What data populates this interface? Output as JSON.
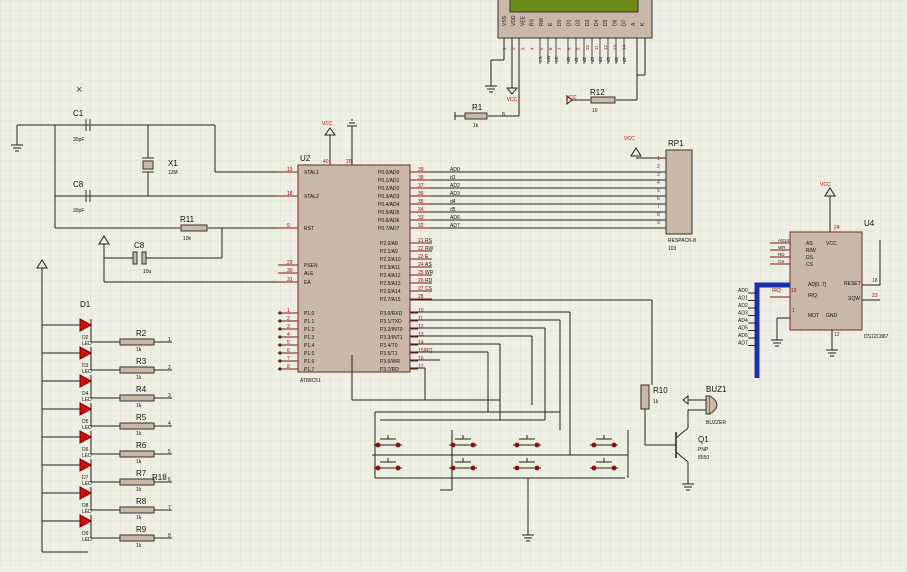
{
  "schematic": {
    "lcd": {
      "pins": [
        "VSS",
        "VDD",
        "VEE",
        "RS",
        "RW",
        "E",
        "D0",
        "D1",
        "D2",
        "D3",
        "D4",
        "D5",
        "D6",
        "D7",
        "A",
        "K"
      ],
      "pin_numbers": [
        "1",
        "2",
        "3",
        "4",
        "5",
        "6",
        "7",
        "8",
        "9",
        "10",
        "11",
        "12",
        "13",
        "14"
      ],
      "data_labels": [
        "d0",
        "d1",
        "d2",
        "d3",
        "d4",
        "d5",
        "d6",
        "d7"
      ],
      "ctrl_labels": [
        "LS",
        "LW",
        "LE"
      ]
    },
    "mcu": {
      "ref": "U2",
      "part": "AT89C51",
      "left_pins": [
        {
          "name": "XTAL1",
          "num": "19"
        },
        {
          "name": "XTAL2",
          "num": "18"
        },
        {
          "name": "RST",
          "num": "9"
        },
        {
          "name": "PSEN",
          "num": "29"
        },
        {
          "name": "ALE",
          "num": "30"
        },
        {
          "name": "EA",
          "num": "31"
        },
        {
          "name": "P1.0",
          "num": "1"
        },
        {
          "name": "P1.1",
          "num": "2"
        },
        {
          "name": "P1.2",
          "num": "3"
        },
        {
          "name": "P1.3",
          "num": "4"
        },
        {
          "name": "P1.4",
          "num": "5"
        },
        {
          "name": "P1.5",
          "num": "6"
        },
        {
          "name": "P1.6",
          "num": "7"
        },
        {
          "name": "P1.7",
          "num": "8"
        }
      ],
      "p0_pins": [
        {
          "name": "P0.0/AD0",
          "num": "39",
          "net": "AD0"
        },
        {
          "name": "P0.1/AD1",
          "num": "38",
          "net": "d1"
        },
        {
          "name": "P0.2/AD2",
          "num": "37",
          "net": "AD2"
        },
        {
          "name": "P0.3/AD3",
          "num": "36",
          "net": "AD3"
        },
        {
          "name": "P0.4/AD4",
          "num": "35",
          "net": "d4"
        },
        {
          "name": "P0.5/AD5",
          "num": "34",
          "net": "d5"
        },
        {
          "name": "P0.6/AD6",
          "num": "33",
          "net": "AD6"
        },
        {
          "name": "P0.7/AD7",
          "num": "32",
          "net": "AD7"
        }
      ],
      "p2_pins": [
        {
          "name": "P2.0/A8",
          "num": "21",
          "net": "RS"
        },
        {
          "name": "P2.1/A9",
          "num": "22",
          "net": "RW"
        },
        {
          "name": "P2.2/A10",
          "num": "23",
          "net": "E"
        },
        {
          "name": "P2.3/A11",
          "num": "24",
          "net": "AS"
        },
        {
          "name": "P2.4/A12",
          "num": "25",
          "net": "WR"
        },
        {
          "name": "P2.5/A13",
          "num": "26",
          "net": "RD"
        },
        {
          "name": "P2.6/A14",
          "num": "27",
          "net": "CS"
        },
        {
          "name": "P2.7/A15",
          "num": "28",
          "net": ""
        }
      ],
      "p3_pins": [
        {
          "name": "P3.0/RXD",
          "num": "10"
        },
        {
          "name": "P3.1/TXD",
          "num": "11"
        },
        {
          "name": "P3.2/INT0",
          "num": "12"
        },
        {
          "name": "P3.3/INT1",
          "num": "13"
        },
        {
          "name": "P3.4/T0",
          "num": "14"
        },
        {
          "name": "P3.5/T1",
          "num": "15IRQ"
        },
        {
          "name": "P3.6/WR",
          "num": "16"
        },
        {
          "name": "P3.7/RD",
          "num": "17"
        }
      ],
      "top_pins": [
        "40",
        "20"
      ]
    },
    "rtc": {
      "ref": "U4",
      "part": "DS12C887",
      "left_pins": [
        "AS",
        "R/W",
        "DS",
        "CS"
      ],
      "bus": "AD[0..7]",
      "irq": "IRQ",
      "irq_num": "19",
      "mot": "MOT",
      "gnd": "GND",
      "vcc": "VCC",
      "reset": "RESET",
      "sqw": "SQW",
      "nums": {
        "vcc": "24",
        "reset": "18",
        "sqw": "23",
        "mot": "1",
        "gnd": "12"
      },
      "bus_labels": [
        "AD0",
        "AD1",
        "AD2",
        "AD3",
        "AD4",
        "AD5",
        "AD6",
        "AD7"
      ],
      "ctrl_labels": [
        "AS14",
        "WR",
        "RD",
        "CS"
      ]
    },
    "rp1": {
      "ref": "RP1",
      "value": "103",
      "type": "RESPACK-8",
      "pins": [
        "1",
        "2",
        "3",
        "4",
        "5",
        "6",
        "7",
        "8",
        "9"
      ]
    },
    "crystal": {
      "ref": "X1",
      "value": "12M"
    },
    "caps": [
      {
        "ref": "C1",
        "value": "30pF"
      },
      {
        "ref": "C8",
        "value": "30pF"
      },
      {
        "ref": "C8",
        "value": "10u"
      }
    ],
    "r11": {
      "ref": "R11",
      "value": "10k"
    },
    "r1": {
      "ref": "R1",
      "value": "1k",
      "net": "8"
    },
    "r12": {
      "ref": "R12",
      "value": "10"
    },
    "r10": {
      "ref": "R10",
      "value": "1k"
    },
    "buzzer": {
      "ref": "BUZ1",
      "value": "BUZZER"
    },
    "q1": {
      "ref": "Q1",
      "type": "PNP",
      "value": "8550"
    },
    "led_first": "D1",
    "leds": [
      {
        "ref": "D2",
        "type": "LED"
      },
      {
        "ref": "D3",
        "type": "LED"
      },
      {
        "ref": "D4",
        "type": "LED"
      },
      {
        "ref": "D5",
        "type": "LED"
      },
      {
        "ref": "D6",
        "type": "LED"
      },
      {
        "ref": "D7",
        "type": "LED"
      },
      {
        "ref": "D8",
        "type": "LED"
      },
      {
        "ref": "D9",
        "type": "LED"
      }
    ],
    "led_resistors": [
      {
        "ref": "R2",
        "value": "1k",
        "num": "1"
      },
      {
        "ref": "R3",
        "value": "1k",
        "num": "2"
      },
      {
        "ref": "R4",
        "value": "1k",
        "num": "3"
      },
      {
        "ref": "R5",
        "value": "1k",
        "num": "4"
      },
      {
        "ref": "R6",
        "value": "1k",
        "num": "5"
      },
      {
        "ref": "R7",
        "value": "1k",
        "num": "6"
      },
      {
        "ref": "R8",
        "value": "1k",
        "num": "7"
      },
      {
        "ref": "R9",
        "value": "1k",
        "num": "8"
      }
    ],
    "r18": "R18",
    "vcc": "VCC",
    "mark": "×",
    "colors": {
      "grid": "#d4d4c4",
      "background": "#eeeee4",
      "chip_fill": "#c9b7a8",
      "pin": "#8a1010",
      "highlight": "#1a2fb0",
      "led": "#cc1111",
      "wire": "#222222"
    }
  }
}
